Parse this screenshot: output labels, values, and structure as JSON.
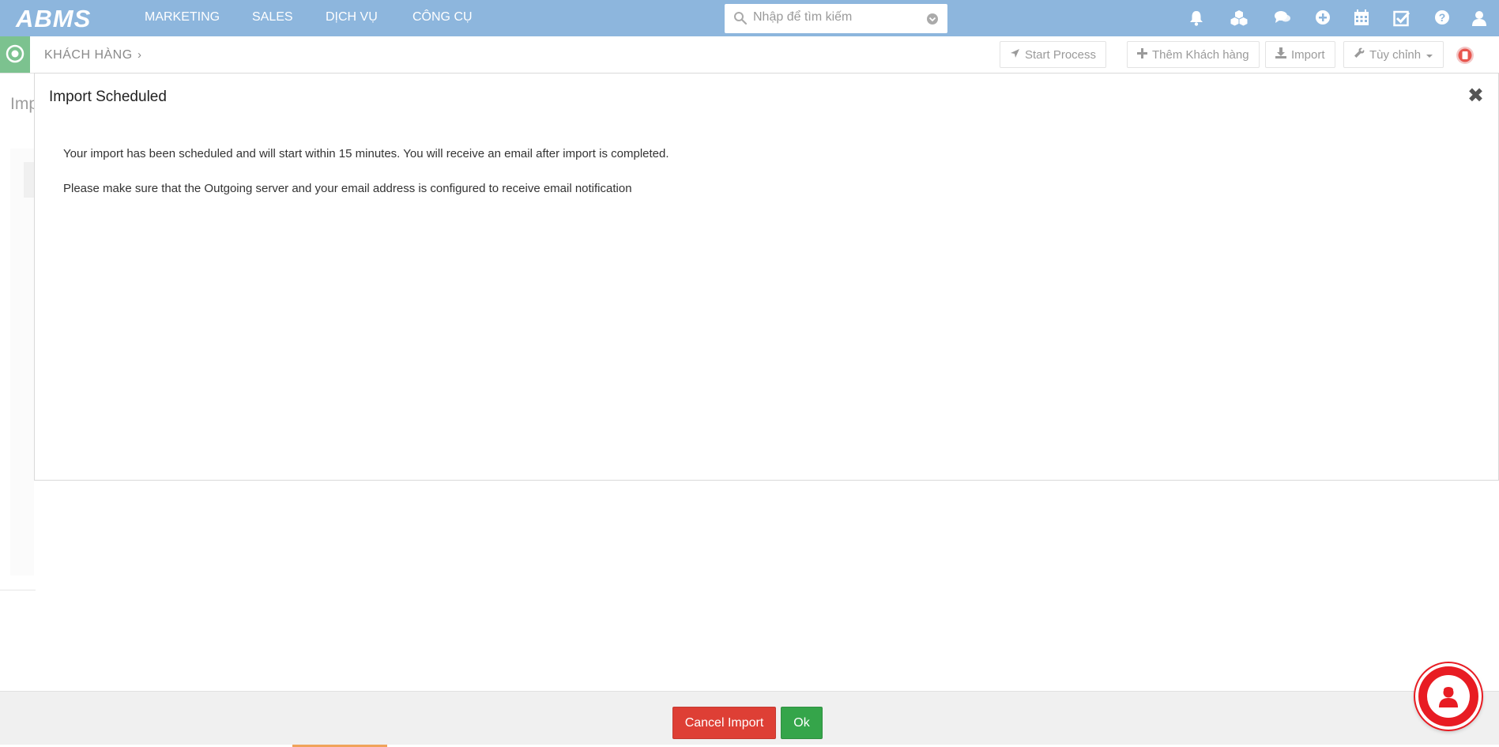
{
  "app": {
    "logo_text": "ABMS",
    "nav": [
      "MARKETING",
      "SALES",
      "DỊCH VỤ",
      "CÔNG CỤ"
    ],
    "search_placeholder": "Nhập để tìm kiếm"
  },
  "subbar": {
    "breadcrumb": "KHÁCH HÀNG",
    "chevron": "›",
    "buttons": {
      "start_process": "Start Process",
      "add_customer": "Thêm Khách hàng",
      "import": "Import",
      "customize": "Tùy chỉnh"
    }
  },
  "background": {
    "partial_heading": "Imp"
  },
  "modal": {
    "title": "Import Scheduled",
    "close_glyph": "✖",
    "line1": "Your import has been scheduled and will start within 15 minutes. You will receive an email after import is completed.",
    "line2": "Please make sure that the Outgoing server and your email address is configured to receive email notification"
  },
  "footer": {
    "cancel_label": "Cancel Import",
    "ok_label": "Ok"
  },
  "colors": {
    "topbar": "#8db6dd",
    "module_accent": "#7cc28f",
    "cancel": "#de3f35",
    "ok": "#35a54a",
    "chat": "#e81c23"
  },
  "icons": [
    "search-icon",
    "chevron-down-icon",
    "bell-icon",
    "cubes-icon",
    "comments-icon",
    "plus-circle-icon",
    "calendar-icon",
    "check-square-icon",
    "question-icon",
    "user-icon",
    "send-icon",
    "plus-icon",
    "download-icon",
    "wrench-icon",
    "caret-down-icon",
    "record-icon",
    "close-icon",
    "chat-user-icon"
  ]
}
